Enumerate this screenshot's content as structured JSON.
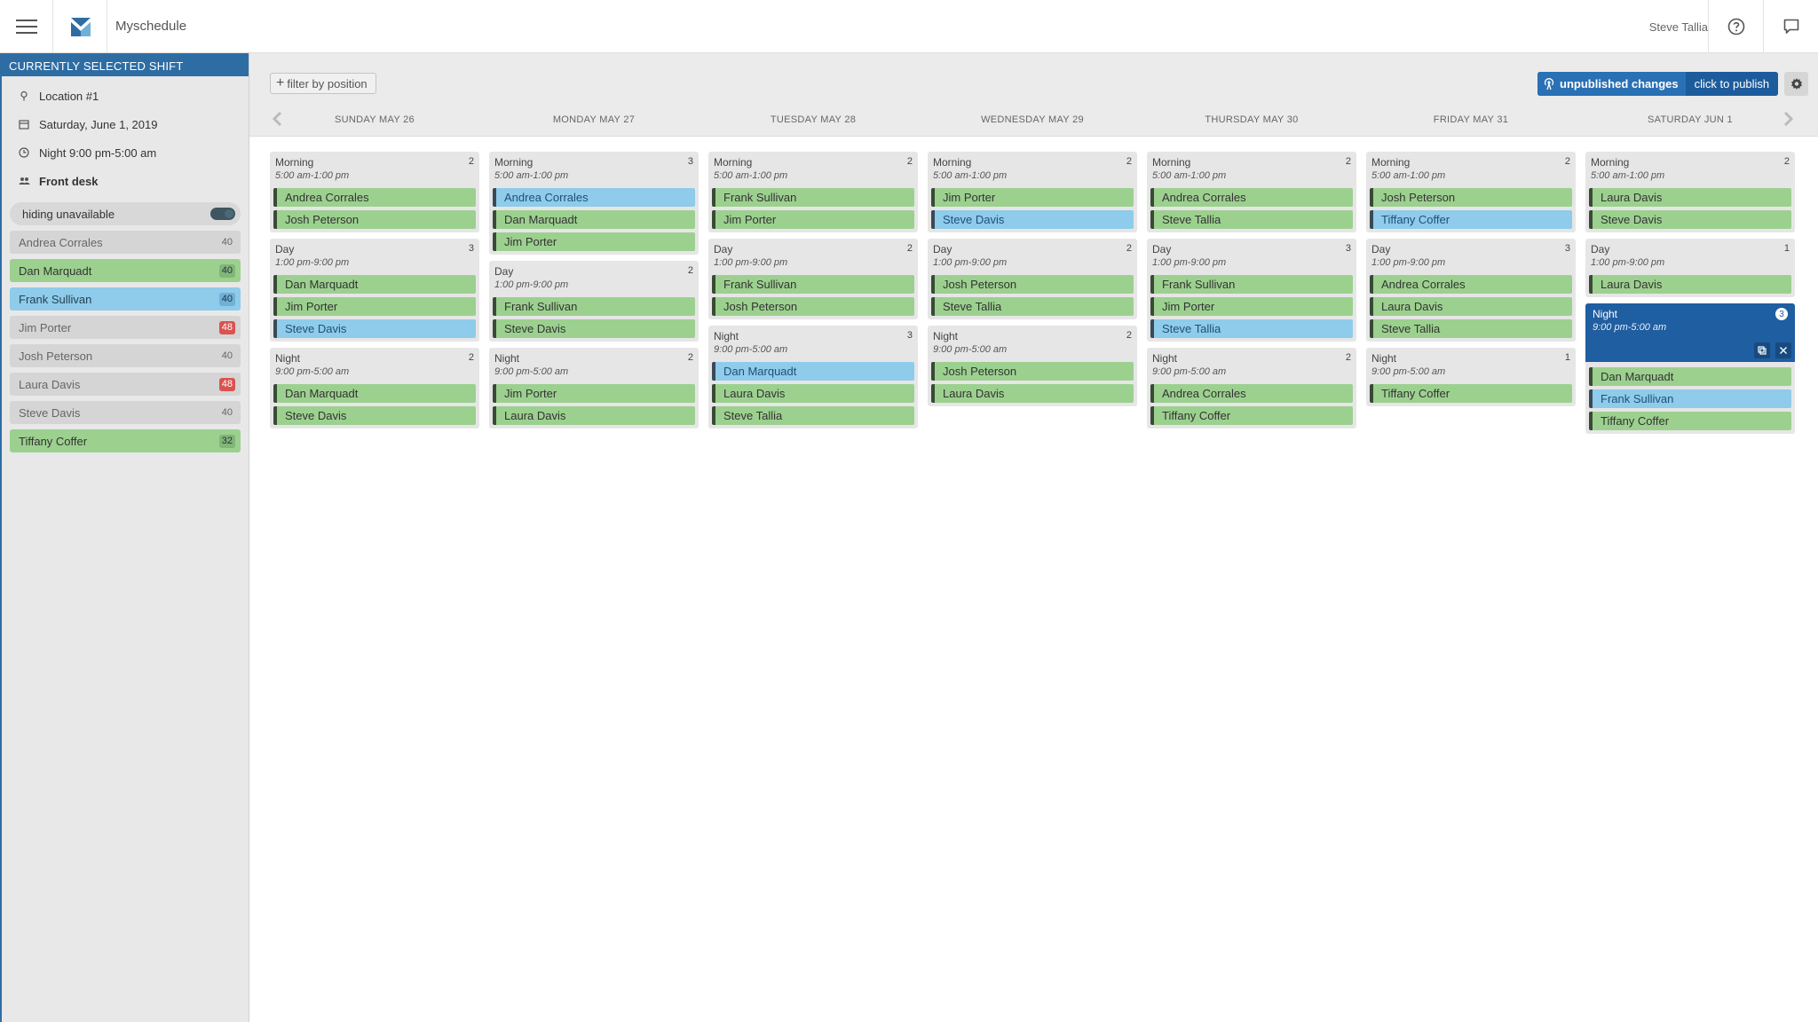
{
  "app": {
    "title": "Myschedule",
    "user": "Steve Tallia"
  },
  "sidebar": {
    "header": "CURRENTLY SELECTED SHIFT",
    "location": "Location #1",
    "date": "Saturday, June 1, 2019",
    "shift": "Night 9:00 pm-5:00 am",
    "position": "Front desk",
    "toggle_label": "hiding unavailable",
    "employees": [
      {
        "name": "Andrea Corrales",
        "hours": "40",
        "state": "grey",
        "over": false
      },
      {
        "name": "Dan Marquadt",
        "hours": "40",
        "state": "green",
        "over": false
      },
      {
        "name": "Frank Sullivan",
        "hours": "40",
        "state": "blue",
        "over": false
      },
      {
        "name": "Jim Porter",
        "hours": "48",
        "state": "grey",
        "over": true
      },
      {
        "name": "Josh Peterson",
        "hours": "40",
        "state": "grey",
        "over": false
      },
      {
        "name": "Laura Davis",
        "hours": "48",
        "state": "grey",
        "over": true
      },
      {
        "name": "Steve Davis",
        "hours": "40",
        "state": "grey",
        "over": false
      },
      {
        "name": "Tiffany Coffer",
        "hours": "32",
        "state": "green",
        "over": false
      }
    ]
  },
  "toolbar": {
    "filter_label": "filter by position",
    "unpublished_label": "unpublished changes",
    "publish_label": "click to publish"
  },
  "days": [
    {
      "label": "SUNDAY MAY 26",
      "shifts": [
        {
          "name": "Morning",
          "time": "5:00 am-1:00 pm",
          "count": "2",
          "people": [
            {
              "n": "Andrea Corrales",
              "c": "green"
            },
            {
              "n": "Josh Peterson",
              "c": "green"
            }
          ]
        },
        {
          "name": "Day",
          "time": "1:00 pm-9:00 pm",
          "count": "3",
          "people": [
            {
              "n": "Dan Marquadt",
              "c": "green"
            },
            {
              "n": "Jim Porter",
              "c": "green"
            },
            {
              "n": "Steve Davis",
              "c": "blue"
            }
          ]
        },
        {
          "name": "Night",
          "time": "9:00 pm-5:00 am",
          "count": "2",
          "people": [
            {
              "n": "Dan Marquadt",
              "c": "green"
            },
            {
              "n": "Steve Davis",
              "c": "green"
            }
          ]
        }
      ]
    },
    {
      "label": "MONDAY MAY 27",
      "shifts": [
        {
          "name": "Morning",
          "time": "5:00 am-1:00 pm",
          "count": "3",
          "people": [
            {
              "n": "Andrea Corrales",
              "c": "blue"
            },
            {
              "n": "Dan Marquadt",
              "c": "green"
            },
            {
              "n": "Jim Porter",
              "c": "green"
            }
          ]
        },
        {
          "name": "Day",
          "time": "1:00 pm-9:00 pm",
          "count": "2",
          "people": [
            {
              "n": "Frank Sullivan",
              "c": "green"
            },
            {
              "n": "Steve Davis",
              "c": "green"
            }
          ]
        },
        {
          "name": "Night",
          "time": "9:00 pm-5:00 am",
          "count": "2",
          "people": [
            {
              "n": "Jim Porter",
              "c": "green"
            },
            {
              "n": "Laura Davis",
              "c": "green"
            }
          ]
        }
      ]
    },
    {
      "label": "TUESDAY MAY 28",
      "shifts": [
        {
          "name": "Morning",
          "time": "5:00 am-1:00 pm",
          "count": "2",
          "people": [
            {
              "n": "Frank Sullivan",
              "c": "green"
            },
            {
              "n": "Jim Porter",
              "c": "green"
            }
          ]
        },
        {
          "name": "Day",
          "time": "1:00 pm-9:00 pm",
          "count": "2",
          "people": [
            {
              "n": "Frank Sullivan",
              "c": "green"
            },
            {
              "n": "Josh Peterson",
              "c": "green"
            }
          ]
        },
        {
          "name": "Night",
          "time": "9:00 pm-5:00 am",
          "count": "3",
          "people": [
            {
              "n": "Dan Marquadt",
              "c": "blue"
            },
            {
              "n": "Laura Davis",
              "c": "green"
            },
            {
              "n": "Steve Tallia",
              "c": "green"
            }
          ]
        }
      ]
    },
    {
      "label": "WEDNESDAY MAY 29",
      "shifts": [
        {
          "name": "Morning",
          "time": "5:00 am-1:00 pm",
          "count": "2",
          "people": [
            {
              "n": "Jim Porter",
              "c": "green"
            },
            {
              "n": "Steve Davis",
              "c": "blue"
            }
          ]
        },
        {
          "name": "Day",
          "time": "1:00 pm-9:00 pm",
          "count": "2",
          "people": [
            {
              "n": "Josh Peterson",
              "c": "green"
            },
            {
              "n": "Steve Tallia",
              "c": "green"
            }
          ]
        },
        {
          "name": "Night",
          "time": "9:00 pm-5:00 am",
          "count": "2",
          "people": [
            {
              "n": "Josh Peterson",
              "c": "green"
            },
            {
              "n": "Laura Davis",
              "c": "green"
            }
          ]
        }
      ]
    },
    {
      "label": "THURSDAY MAY 30",
      "shifts": [
        {
          "name": "Morning",
          "time": "5:00 am-1:00 pm",
          "count": "2",
          "people": [
            {
              "n": "Andrea Corrales",
              "c": "green"
            },
            {
              "n": "Steve Tallia",
              "c": "green"
            }
          ]
        },
        {
          "name": "Day",
          "time": "1:00 pm-9:00 pm",
          "count": "3",
          "people": [
            {
              "n": "Frank Sullivan",
              "c": "green"
            },
            {
              "n": "Jim Porter",
              "c": "green"
            },
            {
              "n": "Steve Tallia",
              "c": "blue"
            }
          ]
        },
        {
          "name": "Night",
          "time": "9:00 pm-5:00 am",
          "count": "2",
          "people": [
            {
              "n": "Andrea Corrales",
              "c": "green"
            },
            {
              "n": "Tiffany Coffer",
              "c": "green"
            }
          ]
        }
      ]
    },
    {
      "label": "FRIDAY MAY 31",
      "shifts": [
        {
          "name": "Morning",
          "time": "5:00 am-1:00 pm",
          "count": "2",
          "people": [
            {
              "n": "Josh Peterson",
              "c": "green"
            },
            {
              "n": "Tiffany Coffer",
              "c": "blue"
            }
          ]
        },
        {
          "name": "Day",
          "time": "1:00 pm-9:00 pm",
          "count": "3",
          "people": [
            {
              "n": "Andrea Corrales",
              "c": "green"
            },
            {
              "n": "Laura Davis",
              "c": "green"
            },
            {
              "n": "Steve Tallia",
              "c": "green"
            }
          ]
        },
        {
          "name": "Night",
          "time": "9:00 pm-5:00 am",
          "count": "1",
          "people": [
            {
              "n": "Tiffany Coffer",
              "c": "green"
            }
          ]
        }
      ]
    },
    {
      "label": "SATURDAY JUN 1",
      "shifts": [
        {
          "name": "Morning",
          "time": "5:00 am-1:00 pm",
          "count": "2",
          "people": [
            {
              "n": "Laura Davis",
              "c": "green"
            },
            {
              "n": "Steve Davis",
              "c": "green"
            }
          ]
        },
        {
          "name": "Day",
          "time": "1:00 pm-9:00 pm",
          "count": "1",
          "people": [
            {
              "n": "Laura Davis",
              "c": "green"
            }
          ]
        },
        {
          "name": "Night",
          "time": "9:00 pm-5:00 am",
          "count": "3",
          "selected": true,
          "people": [
            {
              "n": "Dan Marquadt",
              "c": "green"
            },
            {
              "n": "Frank Sullivan",
              "c": "blue"
            },
            {
              "n": "Tiffany Coffer",
              "c": "green"
            }
          ]
        }
      ]
    }
  ]
}
